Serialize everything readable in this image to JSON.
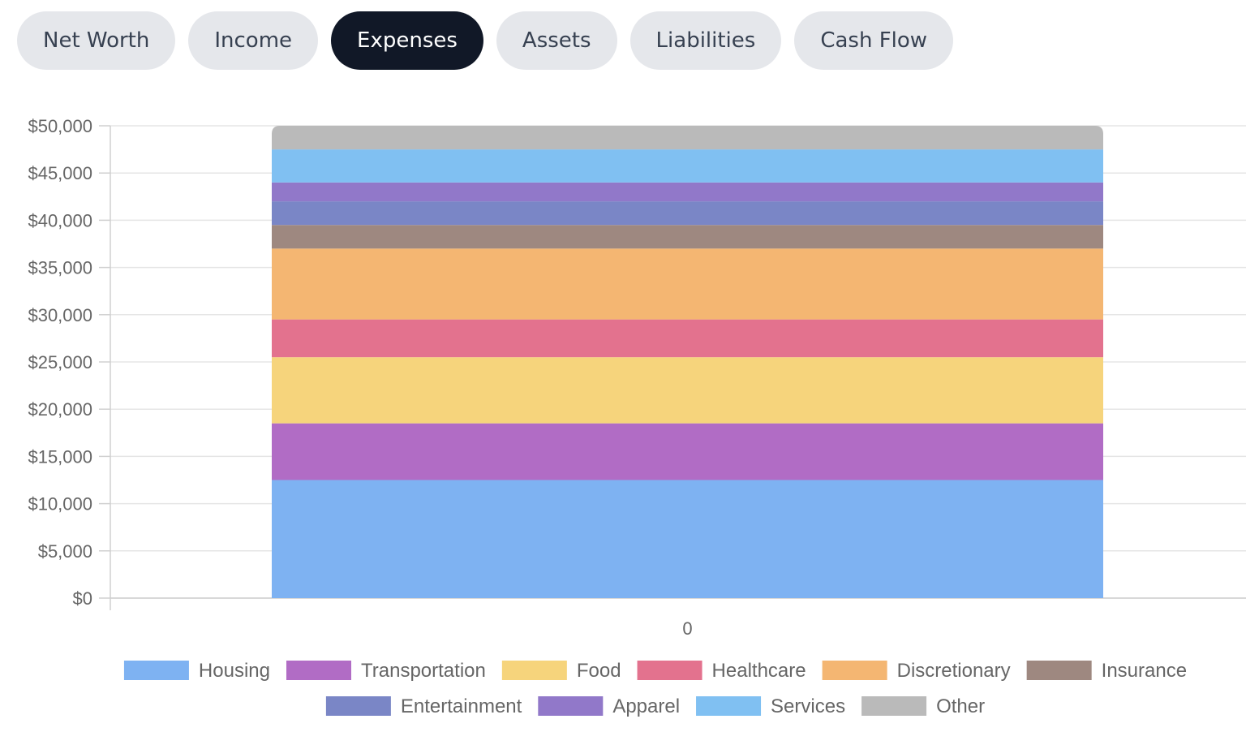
{
  "tabs": [
    {
      "label": "Net Worth",
      "active": false
    },
    {
      "label": "Income",
      "active": false
    },
    {
      "label": "Expenses",
      "active": true
    },
    {
      "label": "Assets",
      "active": false
    },
    {
      "label": "Liabilities",
      "active": false
    },
    {
      "label": "Cash Flow",
      "active": false
    }
  ],
  "chart_data": {
    "type": "bar",
    "stacked": true,
    "categories": [
      "0"
    ],
    "ylim": [
      0,
      50000
    ],
    "y_ticks": [
      "$0",
      "$5,000",
      "$10,000",
      "$15,000",
      "$20,000",
      "$25,000",
      "$30,000",
      "$35,000",
      "$40,000",
      "$45,000",
      "$50,000"
    ],
    "grid": true,
    "legend_position": "bottom",
    "series": [
      {
        "name": "Housing",
        "values": [
          12500
        ],
        "color": "#7eb2f2"
      },
      {
        "name": "Transportation",
        "values": [
          6000
        ],
        "color": "#b16cc5"
      },
      {
        "name": "Food",
        "values": [
          7000
        ],
        "color": "#f6d47c"
      },
      {
        "name": "Healthcare",
        "values": [
          4000
        ],
        "color": "#e3728e"
      },
      {
        "name": "Discretionary",
        "values": [
          7500
        ],
        "color": "#f4b672"
      },
      {
        "name": "Insurance",
        "values": [
          2500
        ],
        "color": "#9e8880"
      },
      {
        "name": "Entertainment",
        "values": [
          2500
        ],
        "color": "#7a86c6"
      },
      {
        "name": "Apparel",
        "values": [
          2000
        ],
        "color": "#9178c9"
      },
      {
        "name": "Services",
        "values": [
          3500
        ],
        "color": "#80c0f2"
      },
      {
        "name": "Other",
        "values": [
          2500
        ],
        "color": "#bababa"
      }
    ]
  }
}
